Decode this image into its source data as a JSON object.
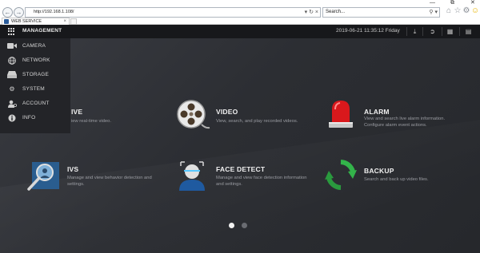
{
  "browser": {
    "address_url": "http://192.168.1.108/",
    "search_placeholder": "Search...",
    "tab_title": "WEB SERVICE",
    "nav_back_icon": "back-arrow-icon",
    "nav_forward_icon": "forward-arrow-icon"
  },
  "header": {
    "title": "MANAGEMENT",
    "datetime": "2019-06-21 11:35:12 Friday",
    "icons": [
      "download-icon",
      "logout-icon",
      "layout-icon",
      "fullscreen-icon"
    ]
  },
  "menu": {
    "items": [
      {
        "label": "CAMERA",
        "icon": "camera-icon"
      },
      {
        "label": "NETWORK",
        "icon": "globe-icon"
      },
      {
        "label": "STORAGE",
        "icon": "storage-icon"
      },
      {
        "label": "SYSTEM",
        "icon": "gears-icon"
      },
      {
        "label": "ACCOUNT",
        "icon": "user-icon"
      },
      {
        "label": "INFO",
        "icon": "info-icon"
      }
    ]
  },
  "tiles": {
    "live": {
      "title": "IVE",
      "desc": "iew real-time video."
    },
    "video": {
      "title": "VIDEO",
      "desc": "View, search, and play recorded videos."
    },
    "alarm": {
      "title": "ALARM",
      "desc1": "View and search live alarm information.",
      "desc2": "Configure alarm event actions."
    },
    "ivs": {
      "title": "IVS",
      "desc1": "Manage and view behavior detection and",
      "desc2": "settings."
    },
    "face": {
      "title": "FACE DETECT",
      "desc1": "Manage and view face detection information",
      "desc2": "and settings."
    },
    "backup": {
      "title": "BACKUP",
      "desc": "Search and back up video files."
    }
  },
  "pager": {
    "pages": 2,
    "current": 1
  },
  "colors": {
    "accent_alarm": "#d9181c",
    "backup_green": "#33b34a",
    "ie_blue": "#2b5c9a"
  }
}
